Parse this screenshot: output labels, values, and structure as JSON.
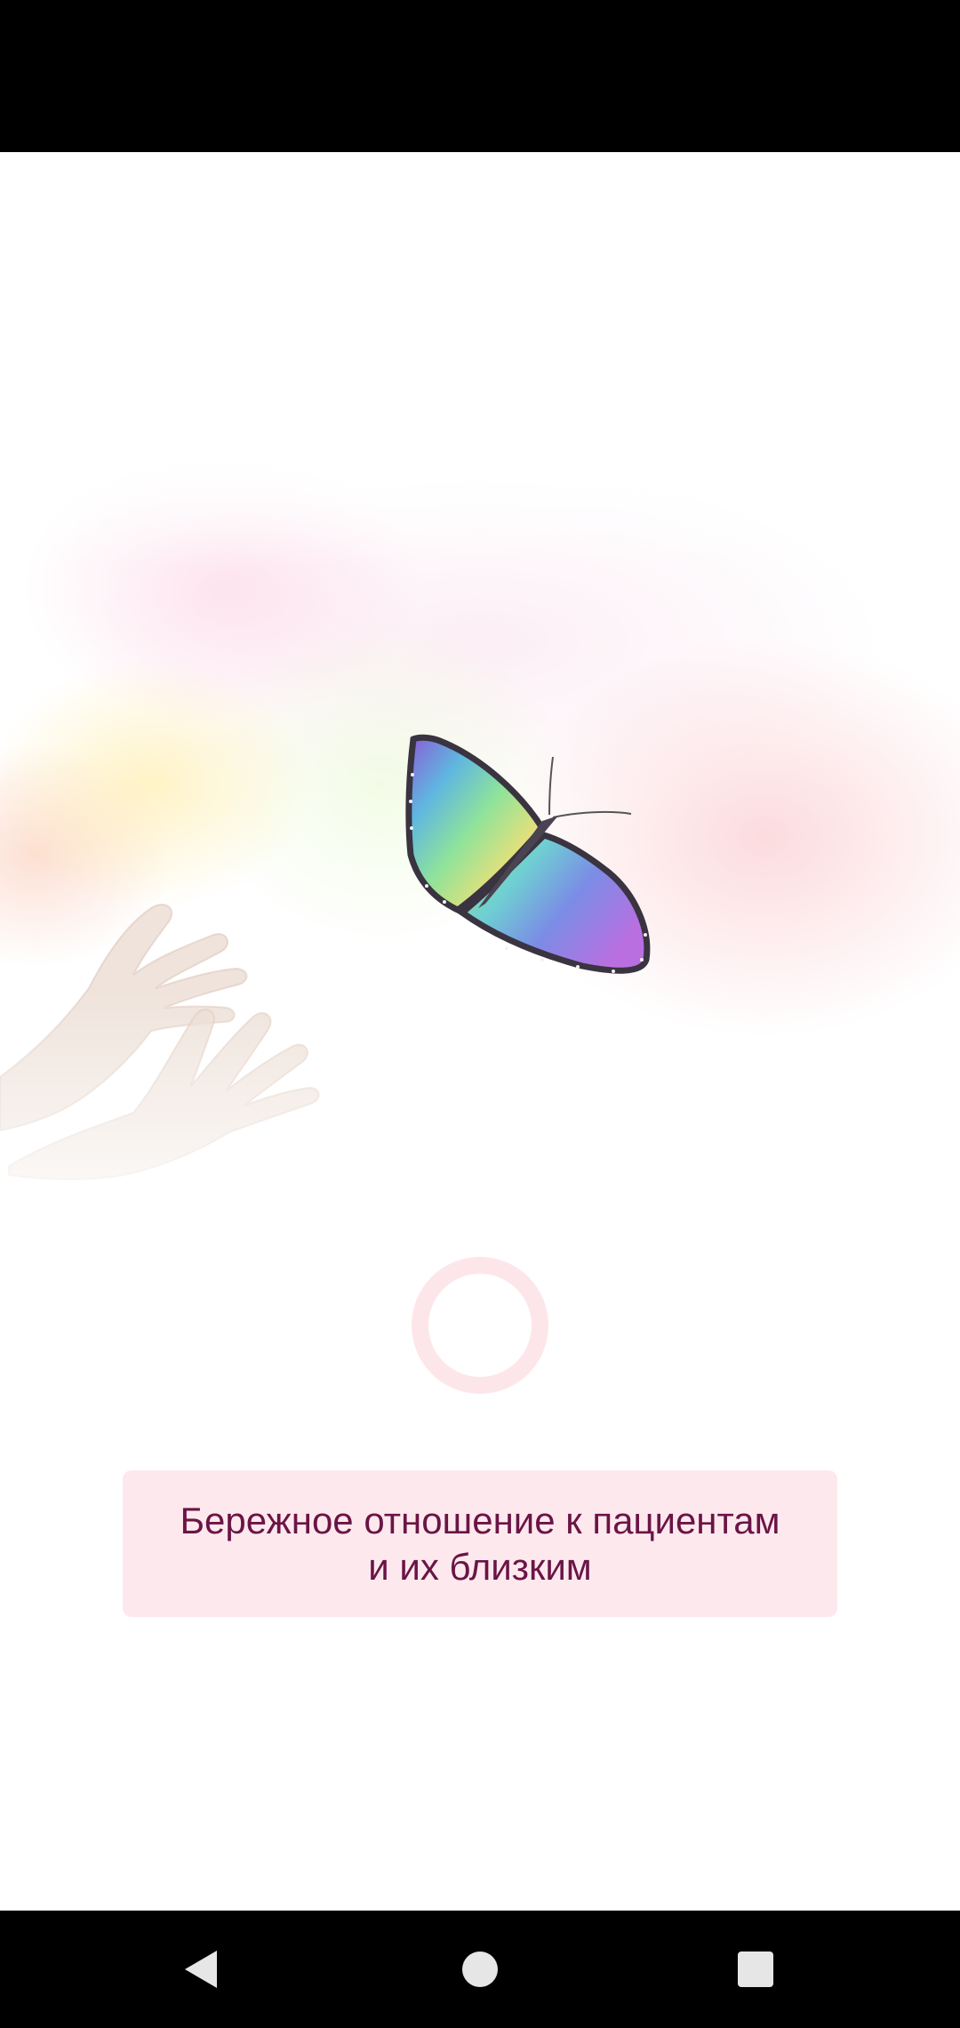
{
  "tagline": {
    "text": "Бережное отношение к пациентам\nи их близким"
  },
  "navigation": {
    "back": "back-icon",
    "home": "home-icon",
    "recents": "recents-icon"
  },
  "colors": {
    "tagline_text": "#6b1446",
    "tagline_background": "#fde9ed",
    "spinner": "#fde6ea",
    "system_bars": "#000000",
    "nav_icons": "#e6e6e6"
  }
}
